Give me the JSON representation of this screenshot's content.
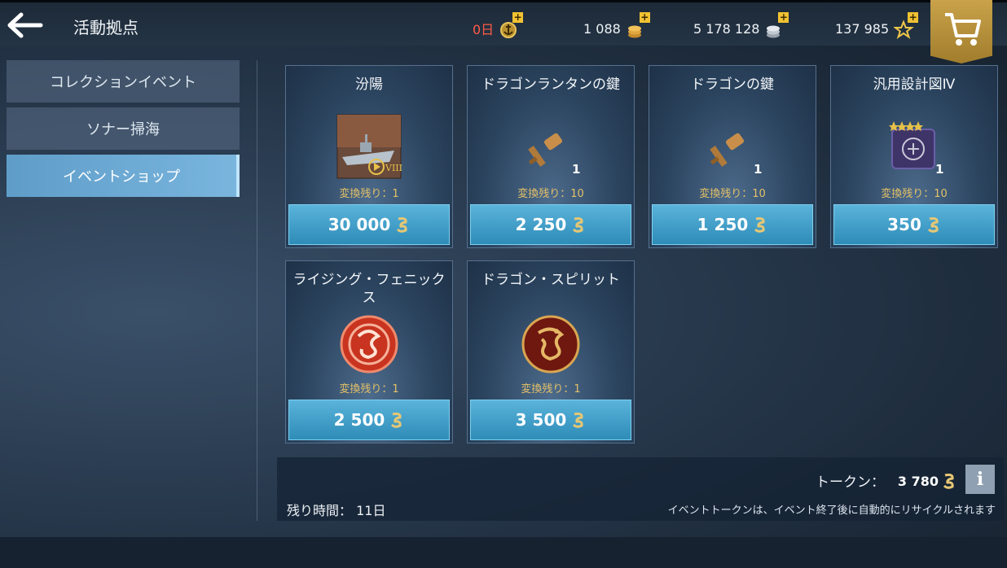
{
  "header": {
    "title": "活動拠点",
    "currencies": [
      {
        "name": "premium-days",
        "value": "0日",
        "icon": "anchor-badge-icon"
      },
      {
        "name": "gold",
        "value": "1 088",
        "icon": "gold-coins-icon"
      },
      {
        "name": "credits",
        "value": "5 178 128",
        "icon": "silver-coins-icon"
      },
      {
        "name": "experience",
        "value": "137 985",
        "icon": "star-icon"
      }
    ],
    "plus_symbol": "+"
  },
  "sidebar": {
    "items": [
      {
        "label": "コレクションイベント",
        "active": false
      },
      {
        "label": "ソナー掃海",
        "active": false
      },
      {
        "label": "イベントショップ",
        "active": true
      }
    ]
  },
  "shop": {
    "items": [
      {
        "title": "汾陽",
        "qty": "",
        "remaining": "変換残り：1",
        "price": "30 000",
        "image": "ship-card-image"
      },
      {
        "title": "ドラゴンランタンの鍵",
        "qty": "1",
        "remaining": "変換残り：10",
        "price": "2 250",
        "image": "bronze-key-icon"
      },
      {
        "title": "ドラゴンの鍵",
        "qty": "1",
        "remaining": "変換残り：10",
        "price": "1 250",
        "image": "bronze-key-icon"
      },
      {
        "title": "汎用設計図Ⅳ",
        "qty": "1",
        "remaining": "変換残り：10",
        "price": "350",
        "image": "blueprint-icon"
      },
      {
        "title": "ライジング・フェニックス",
        "qty": "",
        "remaining": "変換残り：1",
        "price": "2 500",
        "image": "phoenix-emblem-icon"
      },
      {
        "title": "ドラゴン・スピリット",
        "qty": "",
        "remaining": "変換残り：1",
        "price": "3 500",
        "image": "dragon-emblem-icon"
      }
    ],
    "ship_tier": "VIII"
  },
  "footer": {
    "token_label": "トークン：",
    "token_value": "3 780",
    "info_label": "i",
    "time_left": "残り時間： 11日",
    "recycle_note": "イベントトークンは、イベント終了後に自動的にリサイクルされます"
  },
  "colors": {
    "accent_blue": "#3a9ac6",
    "gold": "#c9a24a",
    "remaining_text": "#e3c168",
    "days_red": "#ff5b44"
  }
}
